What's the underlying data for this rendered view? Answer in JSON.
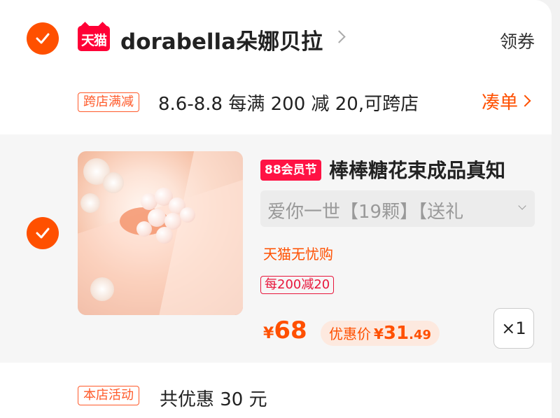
{
  "shop": {
    "logo_text": "天猫",
    "name": "dorabella朵娜贝拉",
    "coupon_label": "领券"
  },
  "promo": {
    "tag": "跨店满减",
    "text": "8.6-8.8 每满 200 减 20,可跨店",
    "action": "凑单"
  },
  "item": {
    "badge": "88会员节",
    "title": "棒棒糖花束成品真知",
    "sku": "爱你一世【19颗】【送礼",
    "service": "天猫无忧购",
    "per_tag": "每200减20",
    "price_symbol": "¥",
    "price": "68",
    "discount_label": "优惠价",
    "discount_symbol": "¥",
    "discount_int": "31",
    "discount_dec": ".49",
    "quantity": "×1"
  },
  "store_activity": {
    "tag": "本店活动",
    "text": "共优惠 30 元"
  },
  "colors": {
    "accent": "#ff5000",
    "tmall_red": "#ff0036",
    "badge_red": "#ff1244"
  }
}
